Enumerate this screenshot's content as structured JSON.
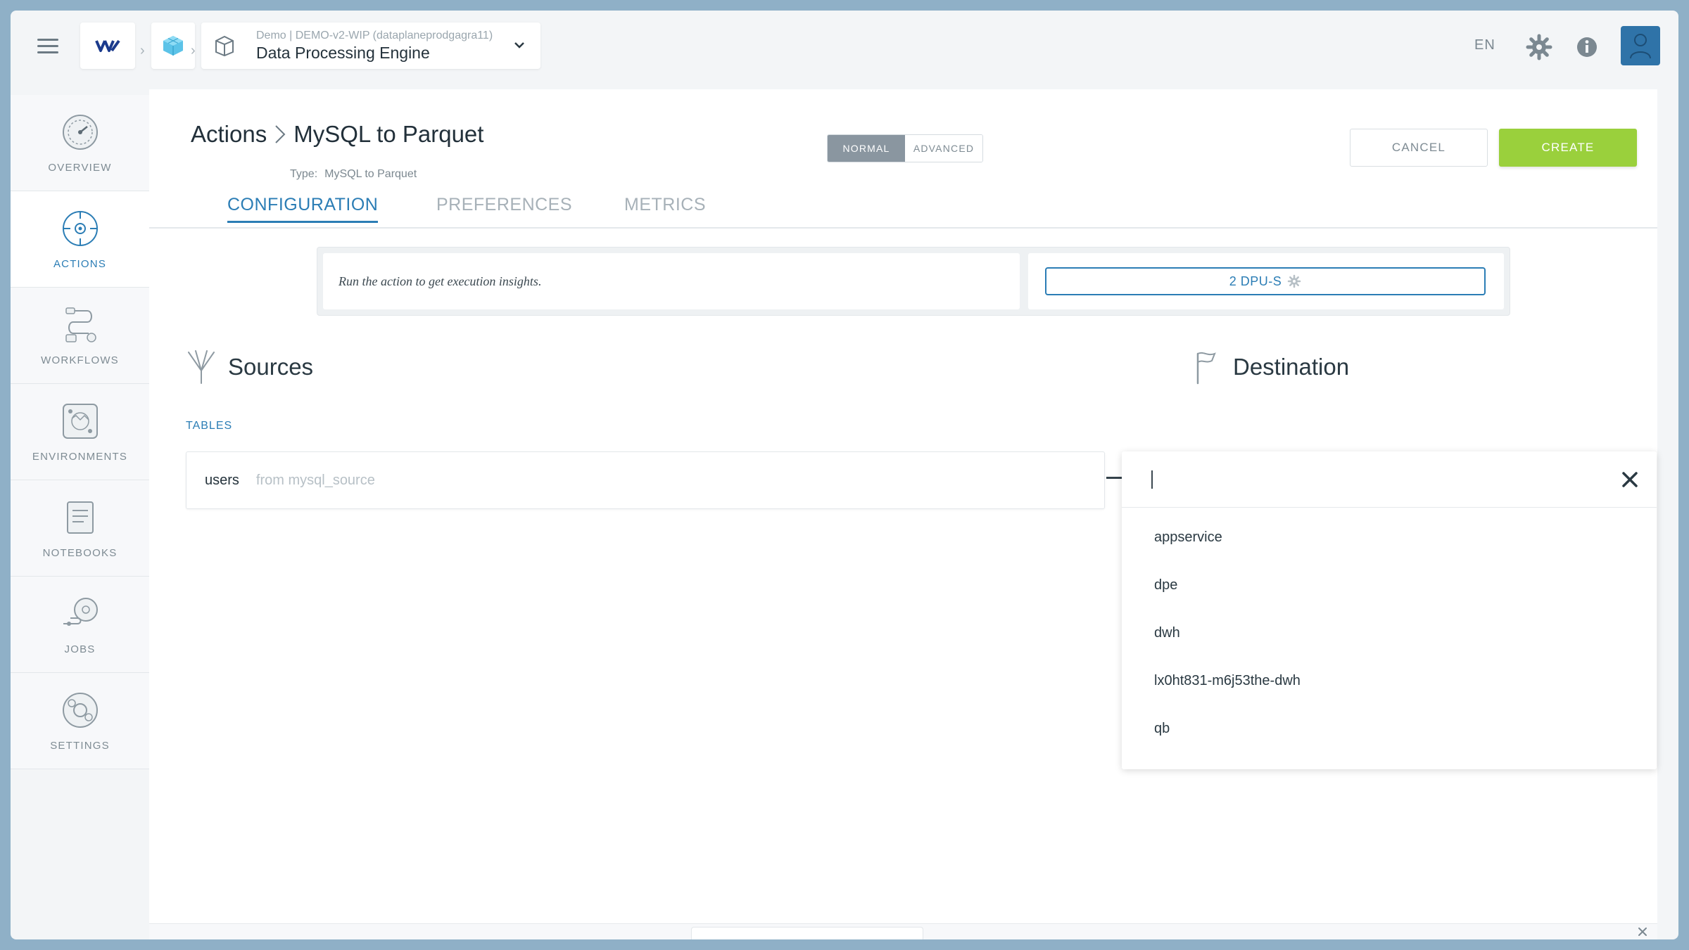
{
  "topbar": {
    "project_sub": "Demo | DEMO-v2-WIP (dataplaneprodgagra11)",
    "project_name": "Data Processing Engine",
    "language": "EN"
  },
  "nav": {
    "items": [
      {
        "label": "OVERVIEW",
        "icon": "gauge-icon",
        "active": false
      },
      {
        "label": "ACTIONS",
        "icon": "target-icon",
        "active": true
      },
      {
        "label": "WORKFLOWS",
        "icon": "workflow-icon",
        "active": false
      },
      {
        "label": "ENVIRONMENTS",
        "icon": "environment-icon",
        "active": false
      },
      {
        "label": "NOTEBOOKS",
        "icon": "notebook-icon",
        "active": false
      },
      {
        "label": "JOBS",
        "icon": "jobs-icon",
        "active": false
      },
      {
        "label": "SETTINGS",
        "icon": "settings-icon",
        "active": false
      }
    ]
  },
  "header": {
    "breadcrumb_root": "Actions",
    "title": "MySQL to Parquet",
    "type_label": "Type:",
    "type_value": "MySQL to Parquet",
    "mode_normal": "NORMAL",
    "mode_advanced": "ADVANCED",
    "cancel": "CANCEL",
    "create": "CREATE"
  },
  "tabs": [
    {
      "label": "CONFIGURATION",
      "active": true
    },
    {
      "label": "PREFERENCES",
      "active": false
    },
    {
      "label": "METRICS",
      "active": false
    }
  ],
  "insights": {
    "message": "Run the action to get execution insights.",
    "dpu_label": "2 DPU-S"
  },
  "sources": {
    "title": "Sources",
    "tables_label": "TABLES",
    "table_name": "users",
    "table_from": "from mysql_source"
  },
  "destination": {
    "title": "Destination",
    "search_value": "",
    "options": [
      "appservice",
      "dpe",
      "dwh",
      "lx0ht831-m6j53the-dwh",
      "qb"
    ]
  },
  "colors": {
    "accent": "#2b7db5",
    "create": "#9ad03c",
    "mode_active": "#8a96a0"
  }
}
